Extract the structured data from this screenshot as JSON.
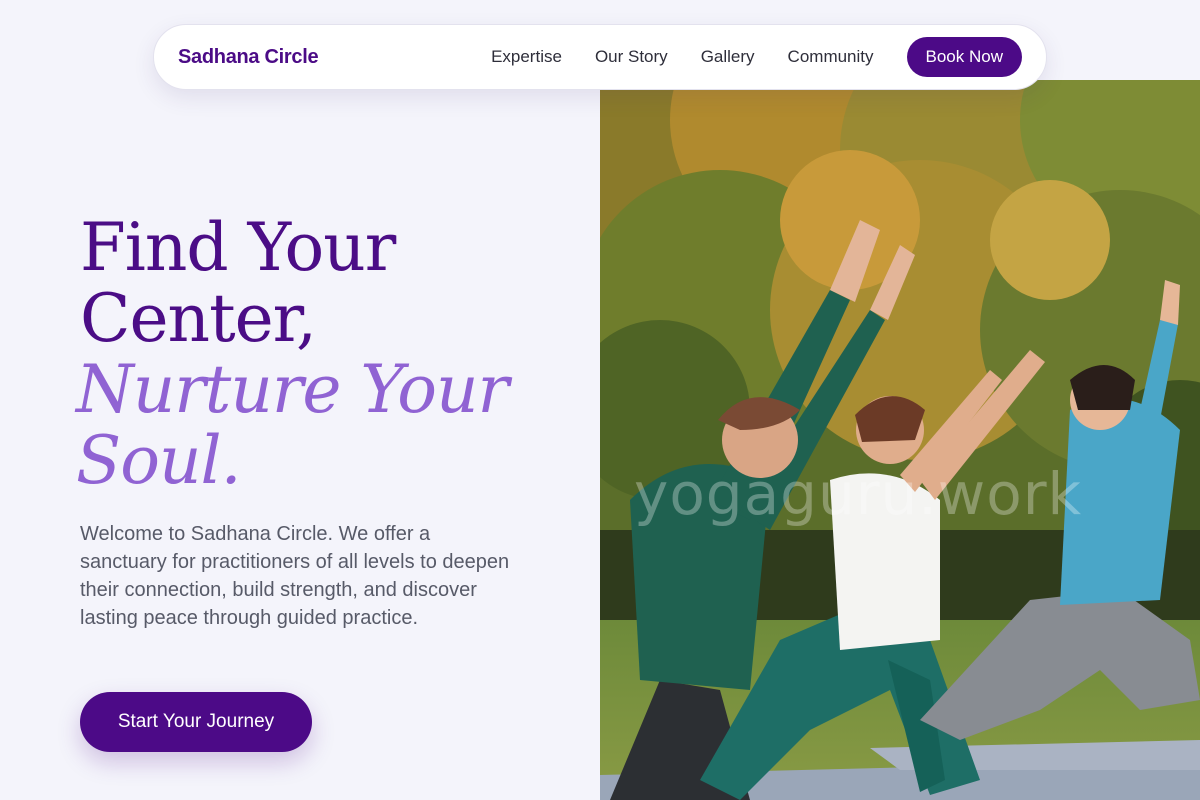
{
  "brand": {
    "name": "Sadhana Circle",
    "color": "#4b0b86"
  },
  "nav": {
    "links": [
      "Expertise",
      "Our Story",
      "Gallery",
      "Community"
    ],
    "cta_label": "Book Now"
  },
  "hero": {
    "headline_lines": [
      "Find Your",
      "Center,"
    ],
    "headline_accent_lines": [
      "Nurture Your",
      "Soul."
    ],
    "intro": "Welcome to Sadhana Circle. We offer a sanctuary for practitioners of all levels to deepen their connection, build strength, and discover lasting peace through guided practice.",
    "cta_label": "Start Your Journey"
  },
  "image": {
    "subject": "group-outdoor-yoga-photo",
    "watermark": "yogaguru.work"
  },
  "colors": {
    "accent": "#4c0a87",
    "accent_light": "#9063d3",
    "background": "#f4f4fb",
    "body_text": "#575a68"
  }
}
